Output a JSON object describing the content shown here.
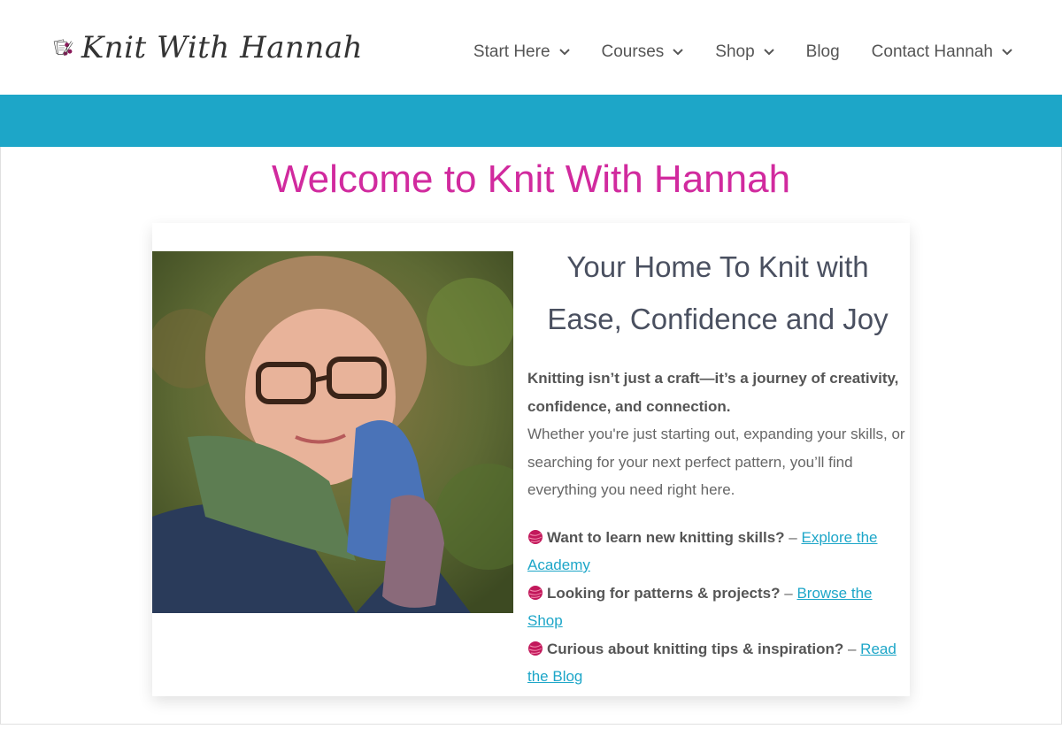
{
  "header": {
    "logo_text": "Knit With Hannah",
    "nav": [
      {
        "label": "Start Here",
        "dropdown": true
      },
      {
        "label": "Courses",
        "dropdown": true
      },
      {
        "label": "Shop",
        "dropdown": true
      },
      {
        "label": "Blog",
        "dropdown": false
      },
      {
        "label": "Contact Hannah",
        "dropdown": true
      }
    ]
  },
  "colors": {
    "accent_teal": "#1da6c8",
    "accent_magenta": "#d12a9e",
    "text_gray": "#666666"
  },
  "main": {
    "welcome_title": "Welcome to Knit With Hannah",
    "headline": "Your Home To Knit with Ease, Confidence and Joy",
    "intro_bold": "Knitting isn’t just a craft—it’s a journey of creativity, confidence, and connection.",
    "intro_text": "Whether you're just starting out, expanding your skills, or searching for your next perfect pattern, you’ll find everything you need right here.",
    "links": [
      {
        "icon": "yarn-ball-icon",
        "question": "Want to learn new knitting skills?",
        "sep": " – ",
        "link": "Explore the Academy"
      },
      {
        "icon": "yarn-ball-icon",
        "question": "Looking for patterns & projects?",
        "sep": " – ",
        "link": "Browse the Shop"
      },
      {
        "icon": "yarn-ball-icon",
        "question": "Curious about knitting tips & inspiration?",
        "sep": " – ",
        "link": " Read the Blog"
      }
    ]
  }
}
